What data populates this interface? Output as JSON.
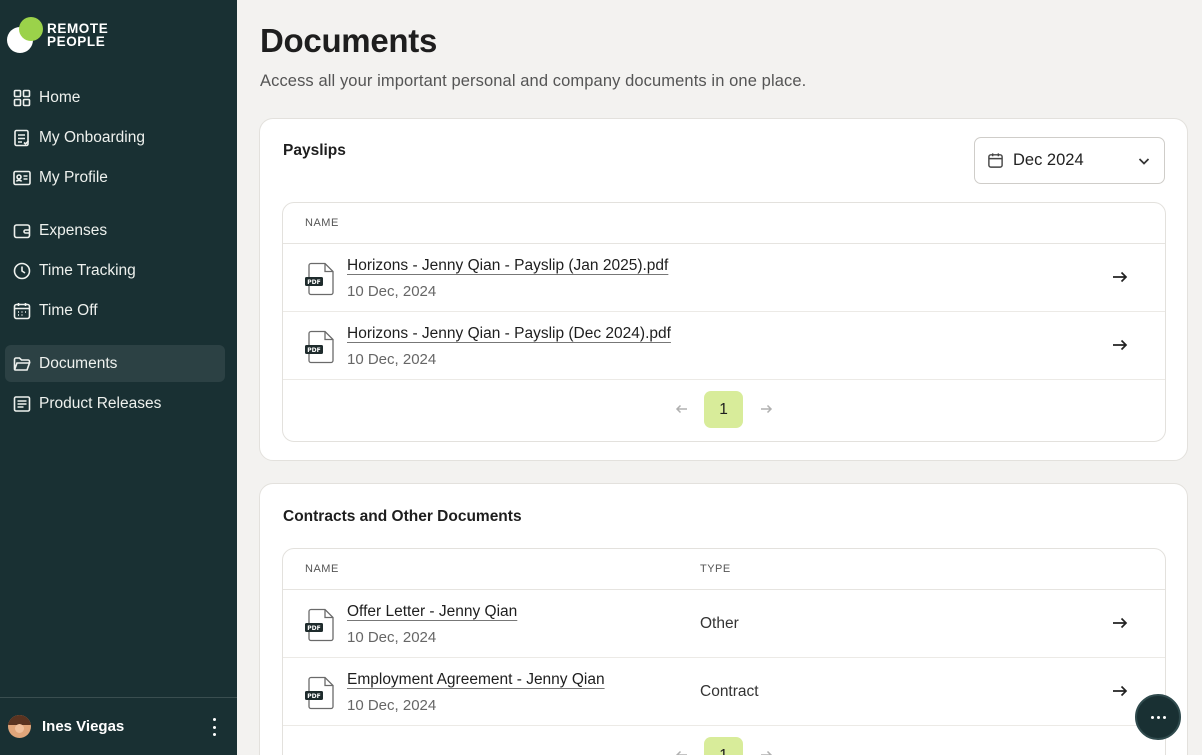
{
  "brand": {
    "line1": "REMOTE",
    "line2": "PEOPLE"
  },
  "nav": [
    {
      "label": "Home",
      "icon": "home-grid-icon"
    },
    {
      "label": "My Onboarding",
      "icon": "checklist-icon"
    },
    {
      "label": "My Profile",
      "icon": "id-card-icon"
    },
    {
      "label": "Expenses",
      "icon": "wallet-icon"
    },
    {
      "label": "Time Tracking",
      "icon": "clock-icon"
    },
    {
      "label": "Time Off",
      "icon": "calendar-icon"
    },
    {
      "label": "Documents",
      "icon": "folder-icon",
      "active": true
    },
    {
      "label": "Product Releases",
      "icon": "news-icon"
    }
  ],
  "user": {
    "name": "Ines Viegas"
  },
  "page": {
    "title": "Documents",
    "subtitle": "Access all your important personal and company documents in one place."
  },
  "payslips": {
    "title": "Payslips",
    "date_filter": "Dec 2024",
    "col_name": "NAME",
    "rows": [
      {
        "name": "Horizons - Jenny Qian - Payslip (Jan 2025).pdf",
        "date": "10 Dec, 2024"
      },
      {
        "name": "Horizons - Jenny Qian - Payslip (Dec 2024).pdf",
        "date": "10 Dec, 2024"
      }
    ],
    "page": "1"
  },
  "contracts": {
    "title": "Contracts and Other Documents",
    "col_name": "NAME",
    "col_type": "TYPE",
    "rows": [
      {
        "name": "Offer Letter - Jenny Qian",
        "date": "10 Dec, 2024",
        "type": "Other"
      },
      {
        "name": "Employment Agreement - Jenny Qian",
        "date": "10 Dec, 2024",
        "type": "Contract"
      }
    ],
    "page": "1"
  },
  "file_icon_label": "PDF",
  "colors": {
    "sidebar": "#193033",
    "accent": "#d8ec9a",
    "brand_green": "#9bd24a",
    "background": "#f3f2f0"
  }
}
